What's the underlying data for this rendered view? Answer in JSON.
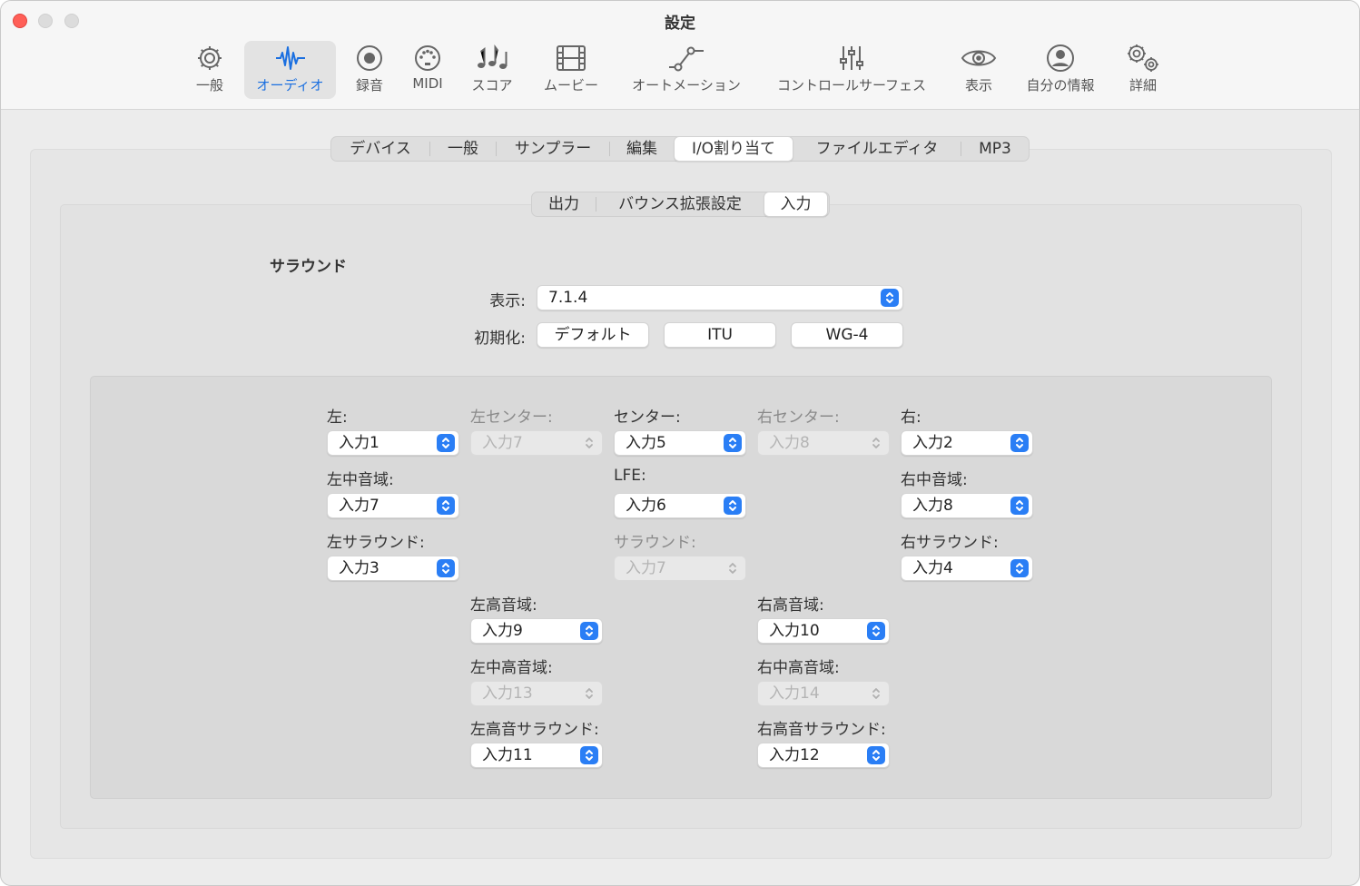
{
  "window": {
    "title": "設定"
  },
  "toolbar": {
    "items": [
      {
        "label": "一般",
        "icon": "gear-icon"
      },
      {
        "label": "オーディオ",
        "icon": "waveform-icon",
        "active": true
      },
      {
        "label": "録音",
        "icon": "record-icon"
      },
      {
        "label": "MIDI",
        "icon": "midi-port-icon"
      },
      {
        "label": "スコア",
        "icon": "music-notes-icon"
      },
      {
        "label": "ムービー",
        "icon": "film-icon"
      },
      {
        "label": "オートメーション",
        "icon": "automation-curve-icon"
      },
      {
        "label": "コントロールサーフェス",
        "icon": "sliders-icon"
      },
      {
        "label": "表示",
        "icon": "eye-icon"
      },
      {
        "label": "自分の情報",
        "icon": "person-icon"
      },
      {
        "label": "詳細",
        "icon": "gears-icon"
      }
    ],
    "accent": "#1a6fe0"
  },
  "tabs": {
    "items": [
      "デバイス",
      "一般",
      "サンプラー",
      "編集",
      "I/O割り当て",
      "ファイルエディタ",
      "MP3"
    ],
    "selected": "I/O割り当て"
  },
  "subtabs": {
    "items": [
      "出力",
      "バウンス拡張設定",
      "入力"
    ],
    "selected": "入力"
  },
  "surround": {
    "title": "サラウンド",
    "show_label": "表示:",
    "show_value": "7.1.4",
    "init_label": "初期化:",
    "init_buttons": [
      "デフォルト",
      "ITU",
      "WG-4"
    ]
  },
  "channels": {
    "left": {
      "label": "左:",
      "value": "入力1",
      "enabled": true
    },
    "left_center": {
      "label": "左センター:",
      "value": "入力7",
      "enabled": false
    },
    "center": {
      "label": "センター:",
      "value": "入力5",
      "enabled": true
    },
    "right_center": {
      "label": "右センター:",
      "value": "入力8",
      "enabled": false
    },
    "right": {
      "label": "右:",
      "value": "入力2",
      "enabled": true
    },
    "left_mid": {
      "label": "左中音域:",
      "value": "入力7",
      "enabled": true
    },
    "lfe": {
      "label": "LFE:",
      "value": "入力6",
      "enabled": true
    },
    "right_mid": {
      "label": "右中音域:",
      "value": "入力8",
      "enabled": true
    },
    "left_surround": {
      "label": "左サラウンド:",
      "value": "入力3",
      "enabled": true
    },
    "surround": {
      "label": "サラウンド:",
      "value": "入力7",
      "enabled": false
    },
    "right_surround": {
      "label": "右サラウンド:",
      "value": "入力4",
      "enabled": true
    },
    "left_top": {
      "label": "左高音域:",
      "value": "入力9",
      "enabled": true
    },
    "right_top": {
      "label": "右高音域:",
      "value": "入力10",
      "enabled": true
    },
    "left_top_mid": {
      "label": "左中高音域:",
      "value": "入力13",
      "enabled": false
    },
    "right_top_mid": {
      "label": "右中高音域:",
      "value": "入力14",
      "enabled": false
    },
    "left_top_surround": {
      "label": "左高音サラウンド:",
      "value": "入力11",
      "enabled": true
    },
    "right_top_surround": {
      "label": "右高音サラウンド:",
      "value": "入力12",
      "enabled": true
    }
  }
}
